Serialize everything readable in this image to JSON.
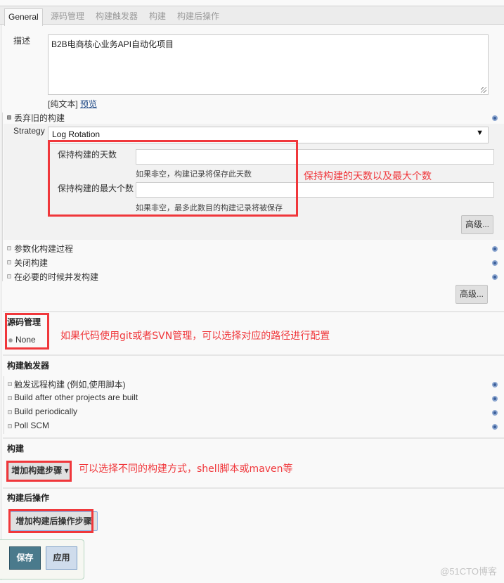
{
  "tabs": [
    {
      "label": "General",
      "active": true
    },
    {
      "label": "源码管理",
      "active": false
    },
    {
      "label": "构建触发器",
      "active": false
    },
    {
      "label": "构建",
      "active": false
    },
    {
      "label": "构建后操作",
      "active": false
    }
  ],
  "general": {
    "description_label": "描述",
    "description_value": "B2B电商核心业务API自动化项目",
    "plain_text_label": "[纯文本]",
    "preview_link": "预览",
    "discard_old_builds": {
      "label": "丢弃旧的构建",
      "checked": true
    },
    "strategy_label": "Strategy",
    "strategy_value": "Log Rotation",
    "days_to_keep": {
      "label": "保持构建的天数",
      "value": "",
      "hint": "如果非空，构建记录将保存此天数"
    },
    "max_builds": {
      "label": "保持构建的最大个数",
      "value": "",
      "hint": "如果非空，最多此数目的构建记录将被保存"
    },
    "advanced_button": "高级...",
    "options": [
      {
        "label": "参数化构建过程",
        "checked": false
      },
      {
        "label": "关闭构建",
        "checked": false
      },
      {
        "label": "在必要的时候并发构建",
        "checked": false
      }
    ],
    "advanced_button_2": "高级..."
  },
  "scm": {
    "title": "源码管理",
    "options": [
      {
        "label": "None",
        "selected": true
      }
    ]
  },
  "triggers": {
    "title": "构建触发器",
    "options": [
      {
        "label": "触发远程构建 (例如,使用脚本)",
        "checked": false
      },
      {
        "label": "Build after other projects are built",
        "checked": false
      },
      {
        "label": "Build periodically",
        "checked": false
      },
      {
        "label": "Poll SCM",
        "checked": false
      }
    ]
  },
  "build": {
    "title": "构建",
    "add_step_button": "增加构建步骤",
    "dropdown_glyph": "▾"
  },
  "post_build": {
    "title": "构建后操作",
    "add_step_button": "增加构建后操作步骤"
  },
  "footer": {
    "save": "保存",
    "apply": "应用"
  },
  "annotations": {
    "retention": "保持构建的天数以及最大个数",
    "scm": "如果代码使用git或者SVN管理，可以选择对应的路径进行配置",
    "build": "可以选择不同的构建方式，shell脚本或maven等",
    "color": "#f0373b"
  },
  "watermark": "@51CTO博客"
}
